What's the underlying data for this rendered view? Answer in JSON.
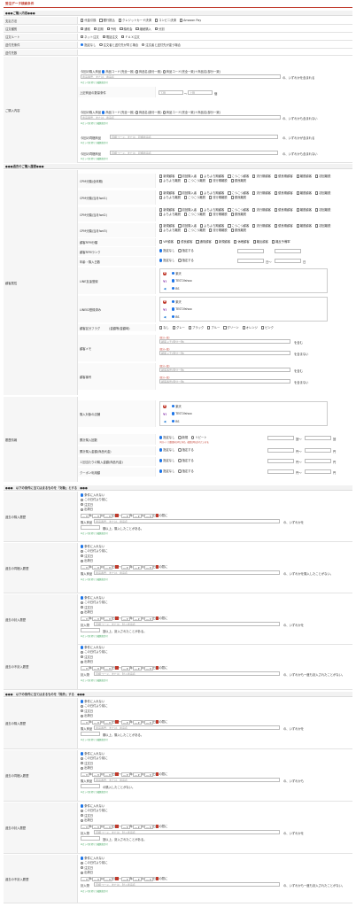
{
  "page_title": "受注データ検索条件",
  "order_section": {
    "header": "●●●ご購入内容●●●",
    "payment": {
      "label": "支払方法",
      "options": [
        "代金引換",
        "銀行振込",
        "クレジットカード決済",
        "コンビニ決済",
        "Amazon Pay"
      ]
    },
    "order_type": {
      "label": "注文種別",
      "options": [
        "通常",
        "定期",
        "予約",
        "頒布会",
        "継続購入",
        "分割"
      ]
    },
    "order_route": {
      "label": "注文ルート",
      "options": [
        "ネット注文",
        "電話注文",
        "ＦＡＸ注文"
      ]
    },
    "delivery": {
      "label": "送付先条件",
      "options": [
        "指定なし",
        "注文者と送付先が同じ場合",
        "注文者と送付先が違う場合"
      ]
    },
    "status": {
      "label": "送付先数"
    },
    "purchase": {
      "label": "ご購入内容",
      "line1_prefix": "今回の購入商品",
      "line1_opts": [
        "商品コード(完全一致)",
        "商品名(部分一致)",
        "商品コード(完全一致)＋商品名(部分一致)"
      ],
      "input_ph": "商品番号、または、商品名",
      "suffix_any": "の、いずれかを含まれる",
      "note1": "※カンマ区切りで複数指定可",
      "limit_label": "上記商品の数量条件",
      "limit_from": "下限",
      "limit_to": "上限",
      "limit_unit": "個",
      "line2_prefix": "今回の購入商品",
      "suffix_none": "の、いずれかも含まれない",
      "line3_prefix": "今回の同梱商品",
      "line3_ph": "同梱コード、または、同梱商品名",
      "suffix_contains": "の、いずれかが含まれる",
      "line4_prefix": "今回の同梱商品",
      "suffix_none2": "の、いずれかも含まれない"
    }
  },
  "customer_section": {
    "header": "●●●過去のご購入履歴●●●",
    "label": "顧客属性",
    "rows": [
      {
        "label": "CPM分類(全体期)",
        "opts": [
          "新規顧客",
          "初回購入者",
          "よちよち期顧客",
          "こつこつ顧客",
          "流行期顧客",
          "優良期顧客",
          "離脱顧客",
          "初回離脱",
          "よちよち離脱",
          "こつこつ離脱",
          "流行期離脱",
          "優良離脱"
        ]
      },
      {
        "label": "CPM分類(当月fwd1)"
      },
      {
        "label": "CPM分類(当月fwd2)"
      },
      {
        "label": "CPM分類(当月fwd3)"
      }
    ],
    "rfm_label": "顧客RFM分類",
    "rfm_opts": [
      "VIP顧客",
      "優良顧客",
      "通常顧客",
      "新規顧客",
      "休眠顧客",
      "離反顧客",
      "離反予備軍"
    ],
    "rfm_rank_label": "顧客RFMランク",
    "rank_opts": [
      "指定なし",
      "指定する"
    ],
    "age_label": "年齢・購入日数",
    "age_unit": "日",
    "age_from_unit": "日～",
    "line_friend_label": "LINE友達登録",
    "line_block_label": "LINEID登録済み",
    "ec_names": [
      "楽天",
      "TEST-Yahoo",
      "BS"
    ],
    "flag_label": "顧客区分フラグ",
    "flag_hint": "(金額等/金額時)",
    "flag_opts": [
      "なし",
      "グレー",
      "ブラック",
      "ブルー",
      "グリーン",
      "オレンジ",
      "ピンク"
    ],
    "memo_label": "顧客メモ",
    "memo_ph": "顧客メモ(部分一致)",
    "memo_tag": "(部分一致)",
    "memo_has": "を含む",
    "memo_not": "を含まない",
    "tel_label": "顧客番号",
    "tel_ph": "顧客番号(部分一致)",
    "shop_label": "購入対象の店舗",
    "history_label": "履歴情報",
    "buy_count_label": "累計購入回数",
    "buy_count_opts": [
      "指定なし",
      "新規",
      "リピート"
    ],
    "buy_count_note": "(1回～)　回数選択の時に有効、複数日時は外れています。",
    "times": "回～",
    "times2": "回",
    "buy_amount_label": "累計購入金額(商品代金)",
    "yen": "円～",
    "yen2": "円",
    "avg_label": "１回当たりの購入金額(商品代金)",
    "coupon_label": "クーポン利用額"
  },
  "include_section": {
    "header": "●●●　以下の条件に当てはまるものを「対象」とする　●●●",
    "blocks": [
      {
        "label": "過去の購入履歴",
        "mode_opts": [
          "条件に入れない",
          "この日付より前に",
          "注文日",
          "出荷日"
        ],
        "ph": "商品番号、または、商品名",
        "line2": "購入商品",
        "suffix": "の、いずれかを",
        "tail": "期以上、購入したことがある。",
        "note": "※カンマ区切りで複数指定可"
      },
      {
        "label": "過去の同梱入履歴",
        "mode_opts": [
          "条件に入れない",
          "この日付より前に",
          "注文日",
          "出荷日"
        ],
        "ph": "商品番号、または、商品名",
        "line2": "購入商品",
        "suffix": "の、いずれかを購入したことがない。",
        "tail": "",
        "note": "※カンマ区切りで複数指定可"
      },
      {
        "label": "過去の封入履歴",
        "mode_opts": [
          "条件に入れない",
          "この日付より前に",
          "注文日",
          "出荷日"
        ],
        "ph": "同梱コード、または、封入商品名",
        "line2": "封入物",
        "suffix": "の、いずれかを",
        "tail": "回以上、封入されたことがある。",
        "note": "※カンマ区切りで複数指定可"
      },
      {
        "label": "過去の不封入履歴",
        "mode_opts": [
          "条件に入れない",
          "この日付より前に",
          "注文日",
          "出荷日"
        ],
        "ph": "同梱コード、または、封入商品名",
        "line2": "封入物",
        "suffix": "の、いずれかも一度も封入されたことがない。",
        "tail": "",
        "note": "※カンマ区切りで複数指定可"
      }
    ]
  },
  "exclude_section": {
    "header": "●●●　以下の条件に当てはまるものを「除外」する　●●●",
    "blocks": [
      {
        "label": "過去の購入履歴",
        "suffix": "の、いずれかを",
        "tail": "期以上、購入したことがある。"
      },
      {
        "label": "過去の同梱入履歴",
        "suffix": "の、いずれかも",
        "tail": "の購入したことがない。"
      },
      {
        "label": "過去の封入履歴",
        "suffix": "の、いずれかを",
        "tail": "回以上、封入されたことがある。"
      },
      {
        "label": "過去の不封入履歴",
        "suffix": "の、いずれかも一度も封入されたことがない。",
        "tail": ""
      }
    ]
  },
  "date": {
    "sep1": "年",
    "sep2": "月",
    "sep3": "日",
    "tilde": "～",
    "range_end": "の間に"
  }
}
